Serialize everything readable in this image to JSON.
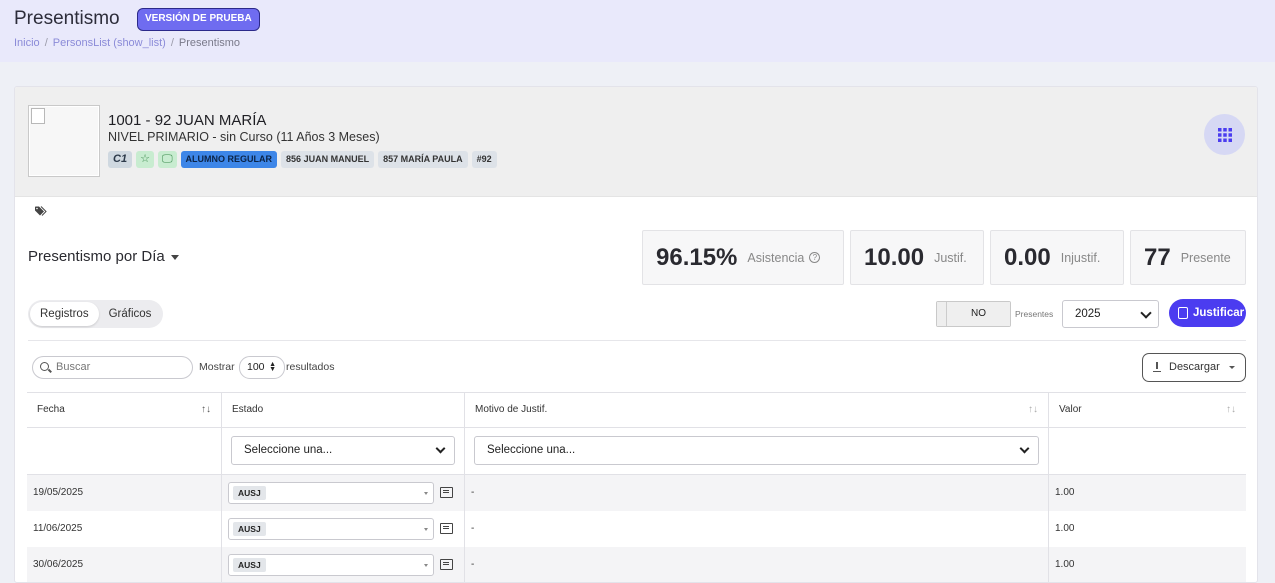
{
  "header": {
    "title": "Presentismo",
    "badge": "VERSIÓN DE PRUEBA",
    "breadcrumb": [
      "Inicio",
      "PersonsList (show_list)",
      "Presentismo"
    ]
  },
  "profile": {
    "name": "1001 - 92 JUAN MARÍA",
    "level": "NIVEL PRIMARIO - sin Curso (11 Años 3 Meses)",
    "chips": {
      "c1": "C1",
      "star": "☆",
      "monitor": "🖵",
      "status": "ALUMNO REGULAR",
      "rel1": "856 JUAN MANUEL",
      "rel2": "857 MARÍA PAULA",
      "id": "#92"
    }
  },
  "section": {
    "title": "Presentismo por Día"
  },
  "stats": [
    {
      "value": "96.15%",
      "label": "Asistencia"
    },
    {
      "value": "10.00",
      "label": "Justif."
    },
    {
      "value": "0.00",
      "label": "Injustif."
    },
    {
      "value": "77",
      "label": "Presente"
    }
  ],
  "tabs": [
    "Registros",
    "Gráficos"
  ],
  "controls": {
    "toggle": "NO",
    "toggle_label": "Presentes",
    "year": "2025",
    "justify": "Justificar",
    "search_placeholder": "Buscar",
    "show": "Mostrar",
    "page_size": "100",
    "results": "resultados",
    "download": "Descargar"
  },
  "table": {
    "columns": [
      "Fecha",
      "Estado",
      "Motivo de Justif.",
      "Valor"
    ],
    "filter_placeholder": "Seleccione una...",
    "rows": [
      {
        "date": "19/05/2025",
        "estado": "AUSJ",
        "motivo": "-",
        "valor": "1.00"
      },
      {
        "date": "11/06/2025",
        "estado": "AUSJ",
        "motivo": "-",
        "valor": "1.00"
      },
      {
        "date": "30/06/2025",
        "estado": "AUSJ",
        "motivo": "-",
        "valor": "1.00"
      }
    ]
  },
  "colors": {
    "accent": "#4b3cf0",
    "badge": "#6f6cf0",
    "status_chip": "#3d86e8",
    "topbar": "#e9e9fb"
  }
}
